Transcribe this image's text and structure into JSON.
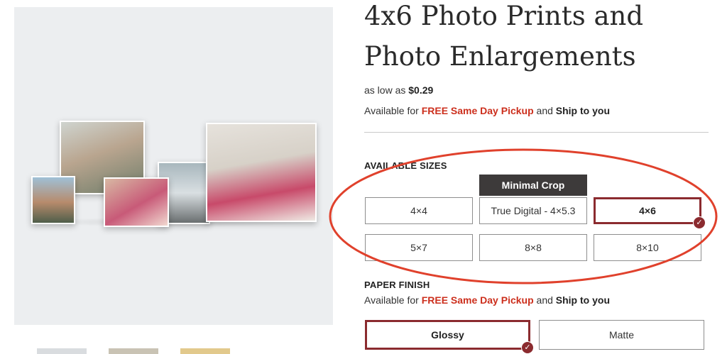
{
  "product": {
    "title": "4x6 Photo Prints and Photo Enlargements",
    "price_prefix": "as low as",
    "price": "$0.29"
  },
  "availability": {
    "prefix": "Available for",
    "pickup": "FREE Same Day Pickup",
    "and": "and",
    "ship": "Ship to you"
  },
  "sizes": {
    "label": "AVAILABLE SIZES",
    "badge": "Minimal Crop",
    "options": [
      "4×4",
      "True Digital - 4×5.3",
      "4×6",
      "5×7",
      "8×8",
      "8×10"
    ],
    "selected": "4×6"
  },
  "finish": {
    "label": "PAPER FINISH",
    "options": [
      "Glossy",
      "Matte"
    ],
    "selected": "Glossy"
  },
  "colors": {
    "accent": "#8b2b2f",
    "promo": "#cc2f1d",
    "annotation": "#e0412c"
  },
  "icons": {
    "selected_check": "check-circle-icon"
  }
}
